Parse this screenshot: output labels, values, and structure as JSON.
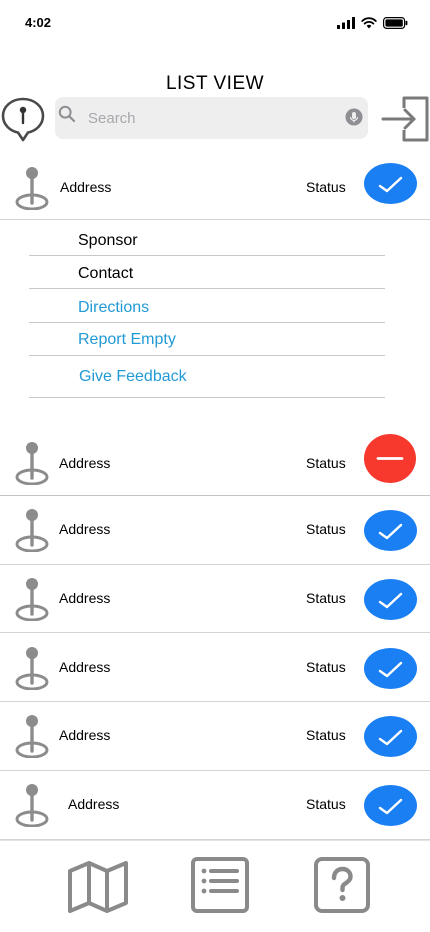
{
  "status_bar": {
    "time": "4:02"
  },
  "title": "LIST VIEW",
  "search": {
    "placeholder": "Search",
    "value": ""
  },
  "icons": {
    "map_pin": "map-pin-icon",
    "search": "magnifier-icon",
    "mic": "microphone-icon",
    "login": "login-arrow-icon",
    "location": "location-pin-icon",
    "check": "checkmark-icon",
    "minus": "minus-icon"
  },
  "colors": {
    "ok": "#1a7ff3",
    "bad": "#f6382d",
    "link": "#229ad5",
    "icon_gray": "#8c8c8c"
  },
  "rows": [
    {
      "address": "Address",
      "status": "Status",
      "state": "ok"
    },
    {
      "address": "Address",
      "status": "Status",
      "state": "bad"
    },
    {
      "address": "Address",
      "status": "Status",
      "state": "ok"
    },
    {
      "address": "Address",
      "status": "Status",
      "state": "ok"
    },
    {
      "address": "Address",
      "status": "Status",
      "state": "ok"
    },
    {
      "address": "Address",
      "status": "Status",
      "state": "ok"
    },
    {
      "address": "Address",
      "status": "Status",
      "state": "ok"
    }
  ],
  "dropdown": {
    "sponsor": "Sponsor",
    "contact": "Contact",
    "directions": "Directions",
    "report_empty": "Report Empty",
    "give_feedback": "Give Feedback"
  },
  "tabs": [
    {
      "name": "map",
      "icon": "map-icon"
    },
    {
      "name": "list",
      "icon": "list-icon"
    },
    {
      "name": "help",
      "icon": "help-icon"
    }
  ]
}
